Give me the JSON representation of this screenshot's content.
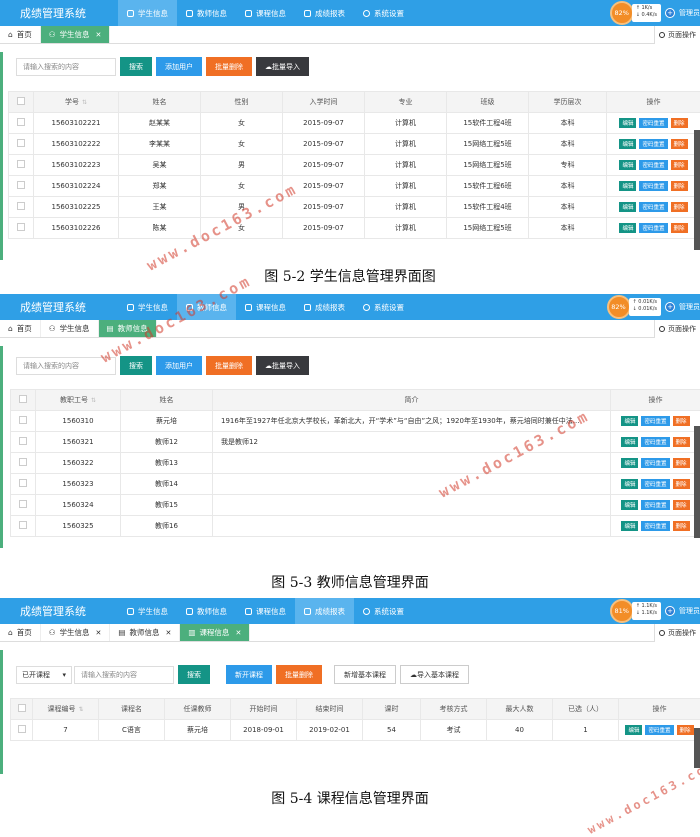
{
  "app": {
    "title": "成绩管理系统"
  },
  "menu": {
    "student": "学生信息",
    "teacher": "教师信息",
    "course": "课程信息",
    "report": "成绩报表",
    "settings": "系统设置"
  },
  "status": {
    "s1": {
      "percent": "82%",
      "up": "1K/s",
      "down": "0.4K/s"
    },
    "s2": {
      "percent": "82%",
      "up": "0.01K/s",
      "down": "0.01K/s"
    },
    "s3": {
      "percent": "81%",
      "up": "1.1K/s",
      "down": "1.1K/s"
    }
  },
  "admin": "管理员",
  "tabs": {
    "home": "首页",
    "student": "学生信息",
    "teacher": "教师信息",
    "course": "课程信息",
    "page_ops": "页面操作"
  },
  "toolbar": {
    "search_placeholder": "请输入搜索的内容",
    "search": "搜索",
    "add_user": "添加用户",
    "batch_delete": "批量删除",
    "batch_import": "批量导入",
    "open_course": "新开课程",
    "new_basic_course": "新增基本课程",
    "import_basic_course": "导入基本课程",
    "course_filter": "已开课程"
  },
  "ops": {
    "edit": "编辑",
    "reset_pwd": "密码重置",
    "delete": "删除"
  },
  "students": {
    "headers": [
      "学号",
      "姓名",
      "性别",
      "入学时间",
      "专业",
      "班级",
      "学历层次",
      "操作"
    ],
    "rows": [
      [
        "15603102221",
        "赵某某",
        "女",
        "2015-09-07",
        "计算机",
        "15软件工程4班",
        "本科"
      ],
      [
        "15603102222",
        "李某某",
        "女",
        "2015-09-07",
        "计算机",
        "15网络工程5班",
        "本科"
      ],
      [
        "15603102223",
        "吴某",
        "男",
        "2015-09-07",
        "计算机",
        "15网络工程5班",
        "专科"
      ],
      [
        "15603102224",
        "郑某",
        "女",
        "2015-09-07",
        "计算机",
        "15软件工程6班",
        "本科"
      ],
      [
        "15603102225",
        "王某",
        "男",
        "2015-09-07",
        "计算机",
        "15软件工程4班",
        "本科"
      ],
      [
        "15603102226",
        "陈某",
        "女",
        "2015-09-07",
        "计算机",
        "15网络工程5班",
        "本科"
      ]
    ]
  },
  "teachers": {
    "headers": [
      "教职工号",
      "姓名",
      "简介",
      "操作"
    ],
    "rows": [
      [
        "1560310",
        "蔡元培",
        "1916年至1927年任北京大学校长，革新北大，开“学术”与“自由”之风；1920年至1930年，蔡元培同时兼任中法..."
      ],
      [
        "1560321",
        "教师12",
        "我是教师12"
      ],
      [
        "1560322",
        "教师13",
        ""
      ],
      [
        "1560323",
        "教师14",
        ""
      ],
      [
        "1560324",
        "教师15",
        ""
      ],
      [
        "1560325",
        "教师16",
        ""
      ]
    ]
  },
  "courses": {
    "headers": [
      "课程编号",
      "课程名",
      "任课教师",
      "开始时间",
      "结束时间",
      "课时",
      "考核方式",
      "最大人数",
      "已选（人）",
      "操作"
    ],
    "rows": [
      [
        "7",
        "C语言",
        "蔡元培",
        "2018-09-01",
        "2019-02-01",
        "54",
        "考试",
        "40",
        "1"
      ]
    ]
  },
  "captions": {
    "c1": "图 5-2 学生信息管理界面图",
    "c2": "图 5-3 教师信息管理界面",
    "c3": "图 5-4 课程信息管理界面"
  },
  "watermark": "www.doc163.com"
}
